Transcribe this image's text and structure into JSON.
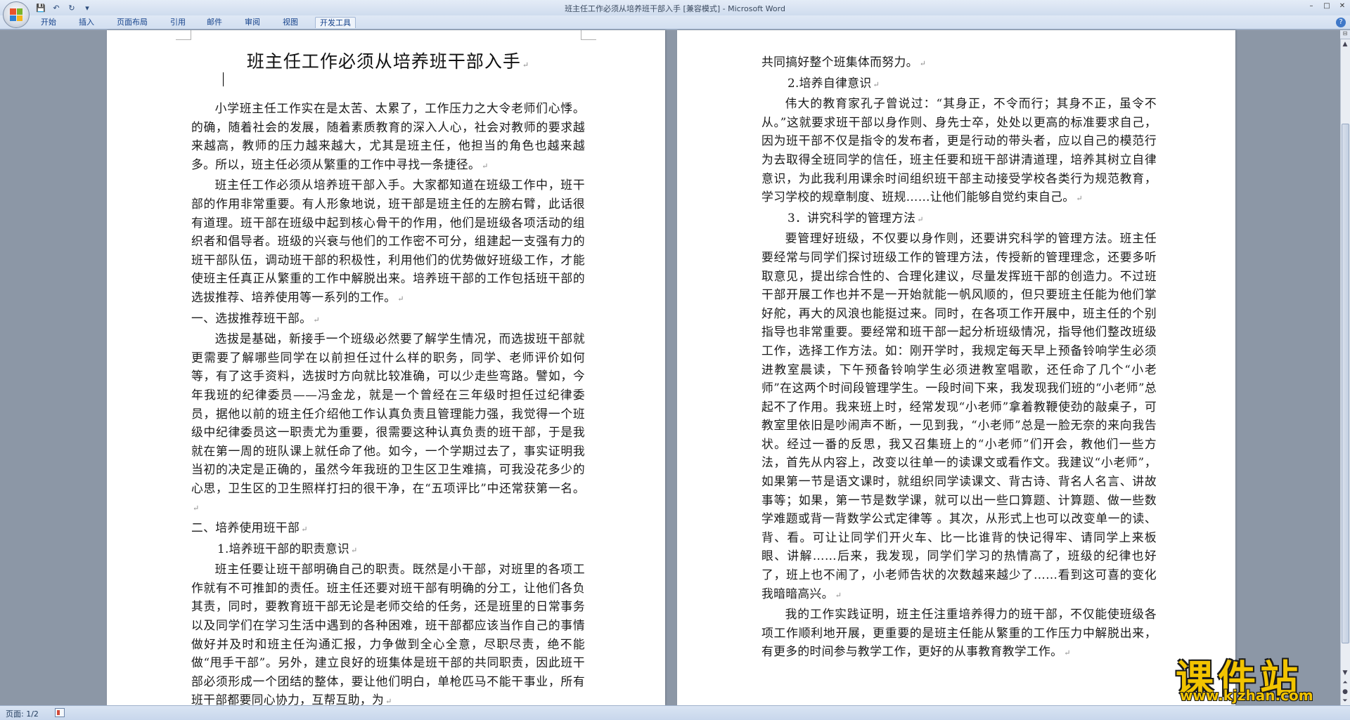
{
  "window": {
    "title": "班主任工作必须从培养班干部入手 [兼容模式] - Microsoft Word",
    "controls": [
      "–",
      "□",
      "✕"
    ]
  },
  "quick_access": {
    "save_icon": "save-icon",
    "undo_icon": "undo-icon",
    "redo_icon": "redo-icon",
    "customize_icon": "customize-icon"
  },
  "ribbon": {
    "tabs": [
      "开始",
      "插入",
      "页面布局",
      "引用",
      "邮件",
      "审阅",
      "视图",
      "开发工具"
    ],
    "active_tab": "开发工具"
  },
  "document": {
    "title": "班主任工作必须从培养班干部入手",
    "page1": [
      {
        "type": "para",
        "text": "小学班主任工作实在是太苦、太累了，工作压力之大令老师们心悸。的确，随着社会的发展，随着素质教育的深入人心，社会对教师的要求越来越高，教师的压力越来越大，尤其是班主任，他担当的角色也越来越多。所以，班主任必须从繁重的工作中寻找一条捷径。"
      },
      {
        "type": "para",
        "text": "班主任工作必须从培养班干部入手。大家都知道在班级工作中，班干部的作用非常重要。有人形象地说，班干部是班主任的左膀右臂，此话很有道理。班干部在班级中起到核心骨干的作用，他们是班级各项活动的组织者和倡导者。班级的兴衰与他们的工作密不可分，组建起一支强有力的班干部队伍，调动班干部的积极性，利用他们的优势做好班级工作，才能使班主任真正从繁重的工作中解脱出来。培养班干部的工作包括班干部的选拔推荐、培养使用等一系列的工作。"
      },
      {
        "type": "heading",
        "text": "一、选拔推荐班干部。"
      },
      {
        "type": "para",
        "text": "选拔是基础，新接手一个班级必然要了解学生情况，而选拔班干部就更需要了解哪些同学在以前担任过什么样的职务，同学、老师评价如何等，有了这手资料，选拔时方向就比较准确，可以少走些弯路。譬如，今年我班的纪律委员——冯金龙，就是一个曾经在三年级时担任过纪律委员，据他以前的班主任介绍他工作认真负责且管理能力强，我觉得一个班级中纪律委员这一职责尤为重要，很需要这种认真负责的班干部，于是我就在第一周的班队课上就任命了他。如今，一个学期过去了，事实证明我当初的决定是正确的，虽然今年我班的卫生区卫生难搞，可我没花多少的心思，卫生区的卫生照样打扫的很干净，在“五项评比”中还常获第一名。"
      },
      {
        "type": "heading",
        "text": "二、培养使用班干部"
      },
      {
        "type": "sub",
        "text": "1.培养班干部的职责意识"
      },
      {
        "type": "para",
        "text": "班主任要让班干部明确自己的职责。既然是小干部，对班里的各项工作就有不可推卸的责任。班主任还要对班干部有明确的分工，让他们各负其责，同时，要教育班干部无论是老师交给的任务，还是班里的日常事务以及同学们在学习生活中遇到的各种困难，班干部都应该当作自己的事情做好并及时和班主任沟通汇报，力争做到全心全意，尽职尽责，绝不能做“甩手干部”。另外，建立良好的班集体是班干部的共同职责，因此班干部必须形成一个团结的整体，要让他们明白，单枪匹马不能干事业，所有班干部都要同心协力，互帮互助，为"
      }
    ],
    "page2": [
      {
        "type": "heading",
        "text": "共同搞好整个班集体而努力。"
      },
      {
        "type": "sub",
        "text": "2.培养自律意识"
      },
      {
        "type": "para",
        "text": "伟大的教育家孔子曾说过：“其身正，不令而行；其身不正，虽令不从。”这就要求班干部以身作则、身先士卒，处处以更高的标准要求自己，因为班干部不仅是指令的发布者，更是行动的带头者，应以自己的模范行为去取得全班同学的信任，班主任要和班干部讲清道理，培养其树立自律意识，为此我利用课余时间组织班干部主动接受学校各类行为规范教育，学习学校的规章制度、班规……让他们能够自觉约束自己。"
      },
      {
        "type": "sub",
        "text": "3．讲究科学的管理方法"
      },
      {
        "type": "para",
        "text": "要管理好班级，不仅要以身作则，还要讲究科学的管理方法。班主任要经常与同学们探讨班级工作的管理方法，传授新的管理理念，还要多听取意见，提出综合性的、合理化建议，尽量发挥班干部的创造力。不过班干部开展工作也并不是一开始就能一帆风顺的，但只要班主任能为他们掌好舵，再大的风浪也能挺过来。同时，在各项工作开展中，班主任的个别指导也非常重要。要经常和班干部一起分析班级情况，指导他们整改班级工作，选择工作方法。如：刚开学时，我规定每天早上预备铃响学生必须进教室晨读，下午预备铃响学生必须进教室唱歌，还任命了几个“小老师”在这两个时间段管理学生。一段时间下来，我发现我们班的“小老师”总起不了作用。我来班上时，经常发现“小老师”拿着教鞭使劲的敲桌子，可教室里依旧是吵闹声不断，一见到我，“小老师”总是一脸无奈的来向我告状。经过一番的反思，我又召集班上的“小老师”们开会，教他们一些方法，首先从内容上，改变以往单一的读课文或看作文。我建议“小老师”，如果第一节是语文课时，就组织同学读课文、背古诗、背名人名言、讲故事等；如果，第一节是数学课，就可以出一些口算题、计算题、做一些数学难题或背一背数学公式定律等 。其次，从形式上也可以改变单一的读、背、看。可让让同学们开火车、比一比谁背的快记得牢、请同学上来板眼、讲解……后来，我发现，同学们学习的热情高了，班级的纪律也好了，班上也不闹了，小老师告状的次数越来越少了……看到这可喜的变化我暗暗高兴。"
      },
      {
        "type": "para",
        "text": "我的工作实践证明，班主任注重培养得力的班干部，不仅能使班级各项工作顺利地开展，更重要的是班主任能从繁重的工作压力中解脱出来，有更多的时间参与教学工作，更好的从事教育教学工作。"
      }
    ],
    "paragraph_mark": "↵"
  },
  "statusbar": {
    "page_info": "页面: 1/2"
  },
  "watermark": {
    "title": "课件站",
    "url": "www.kjzhan.com"
  }
}
